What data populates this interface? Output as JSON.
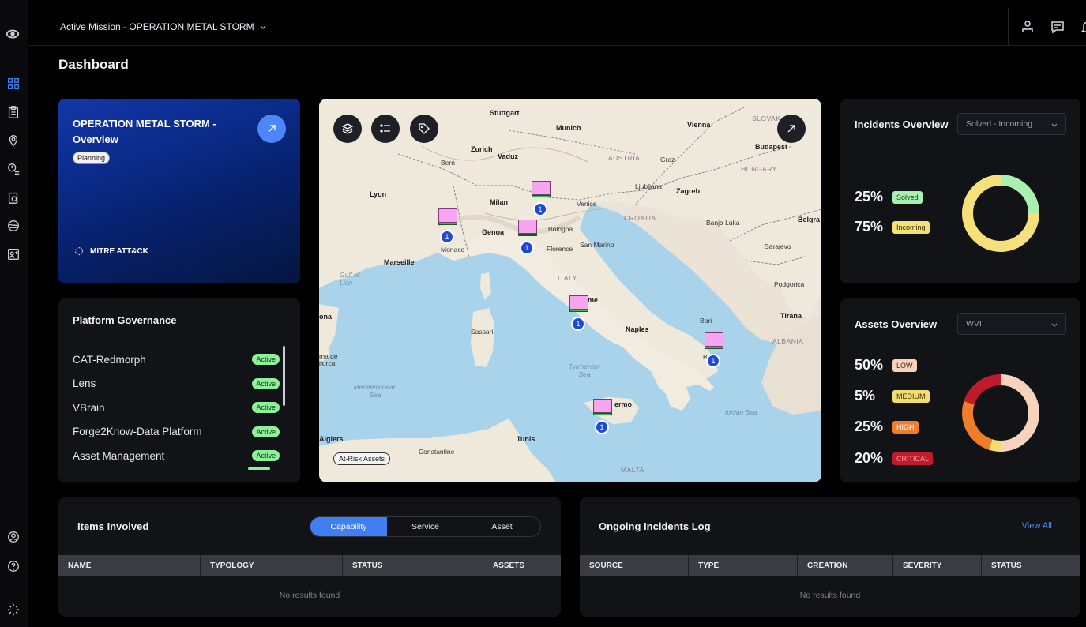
{
  "header": {
    "mission_label": "Active Mission - OPERATION METAL STORM",
    "page_title": "Dashboard"
  },
  "operation": {
    "title": "OPERATION METAL STORM - Overview",
    "status": "Planning",
    "framework": "MITRE ATT&CK"
  },
  "governance": {
    "title": "Platform Governance",
    "items": [
      {
        "name": "CAT-Redmorph",
        "status": "Active"
      },
      {
        "name": "Lens",
        "status": "Active"
      },
      {
        "name": "VBrain",
        "status": "Active"
      },
      {
        "name": "Forge2Know-Data Platform",
        "status": "Active"
      },
      {
        "name": "Asset Management",
        "status": "Active"
      }
    ]
  },
  "map": {
    "legend_chip": "At-Risk Assets",
    "markers": [
      {
        "count": "1"
      },
      {
        "count": "1"
      },
      {
        "count": "1"
      },
      {
        "count": "1"
      },
      {
        "count": "1"
      },
      {
        "count": "1"
      }
    ],
    "labels": {
      "stuttgart": "Stuttgart",
      "munich": "Munich",
      "vienna": "Vienna",
      "slovakia": "SLOVAK",
      "zurich": "Zurich",
      "vaduz": "Vaduz",
      "bern": "Bern",
      "austria": "AUSTRIA",
      "graz": "Graz",
      "budapest": "Budapest",
      "hungary": "HUNGARY",
      "ljubljana": "Ljubljana",
      "zagreb": "Zagreb",
      "lyon": "Lyon",
      "milan": "Milan",
      "venice": "Venice",
      "croatia": "CROATIA",
      "banja_luka": "Banja Luka",
      "belgrade": "Belgra",
      "genoa": "Genoa",
      "bologna": "Bologna",
      "monaco": "Monaco",
      "florence": "Florence",
      "san_marino": "San Marino",
      "sarajevo": "Sarajevo",
      "marseille": "Marseille",
      "gulf_lion": "Gulf of Lion",
      "italy": "ITALY",
      "podgorica": "Podgorica",
      "rome": "me",
      "tirana": "Tirana",
      "sassari": "Sassari",
      "naples": "Naples",
      "bari": "Bari",
      "albania": "ALBANIA",
      "ona": "ona",
      "palma": "ma de llorca",
      "tyrrhenian": "Tyrrhenian Sea",
      "mediterranean": "Mediterranean Sea",
      "ionian": "Ionian Sea",
      "palermo": "ermo",
      "algiers": "Algiers",
      "tunis": "Tunis",
      "constantine": "Constantine",
      "malta": "MALTA",
      "taranto": "B Ta"
    }
  },
  "incidents": {
    "title": "Incidents Overview",
    "filter": "Solved - Incoming",
    "stats": [
      {
        "pct": "25%",
        "label": "Solved",
        "value": 25,
        "color": "#a8f0b0"
      },
      {
        "pct": "75%",
        "label": "Incoming",
        "value": 75,
        "color": "#f5e07a"
      }
    ]
  },
  "assets": {
    "title": "Assets Overview",
    "filter": "WVI",
    "stats": [
      {
        "pct": "50%",
        "label": "LOW",
        "value": 50,
        "color": "#f7d2bc"
      },
      {
        "pct": "5%",
        "label": "MEDIUM",
        "value": 5,
        "color": "#f3dd70"
      },
      {
        "pct": "25%",
        "label": "HIGH",
        "value": 25,
        "color": "#ef7d2a"
      },
      {
        "pct": "20%",
        "label": "CRITICAL",
        "value": 20,
        "color": "#bf1b2a"
      }
    ]
  },
  "items_involved": {
    "title": "Items Involved",
    "tabs": [
      "Capability",
      "Service",
      "Asset"
    ],
    "columns": [
      "NAME",
      "TYPOLOGY",
      "STATUS",
      "ASSETS"
    ],
    "empty": "No results found"
  },
  "incidents_log": {
    "title": "Ongoing Incidents Log",
    "view_all": "View All",
    "columns": [
      "SOURCE",
      "TYPE",
      "CREATION",
      "SEVERITY",
      "STATUS"
    ],
    "empty": "No results found"
  }
}
